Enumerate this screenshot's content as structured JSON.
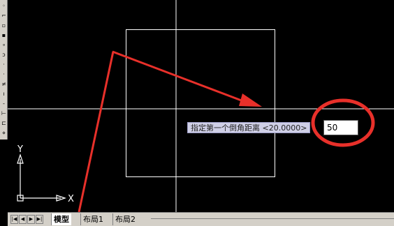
{
  "left_toolbar": {
    "icons": [
      "copy-icon",
      "mirror-icon",
      "offset-icon",
      "array-icon",
      "move-icon",
      "rotate-icon",
      "scale-icon",
      "stretch-icon",
      "trim-icon",
      "extend-icon",
      "break-icon",
      "chamfer-icon",
      "fillet-icon",
      "explode-icon"
    ]
  },
  "ucs": {
    "x_label": "X",
    "y_label": "Y"
  },
  "dynamic_input": {
    "prompt": "指定第一个倒角距离 <20.0000>",
    "value": "50"
  },
  "tabs": {
    "nav_buttons": [
      "first-icon",
      "prev-icon",
      "next-icon",
      "last-icon"
    ],
    "items": [
      {
        "label": "模型",
        "active": true
      },
      {
        "label": "布局1",
        "active": false
      },
      {
        "label": "布局2",
        "active": false
      }
    ]
  },
  "colors": {
    "canvas": "#000000",
    "geometry": "#ffffff",
    "annotation_red": "#e8302a",
    "prompt_bg": "#cfcfe6",
    "chrome": "#d4d0c8"
  }
}
